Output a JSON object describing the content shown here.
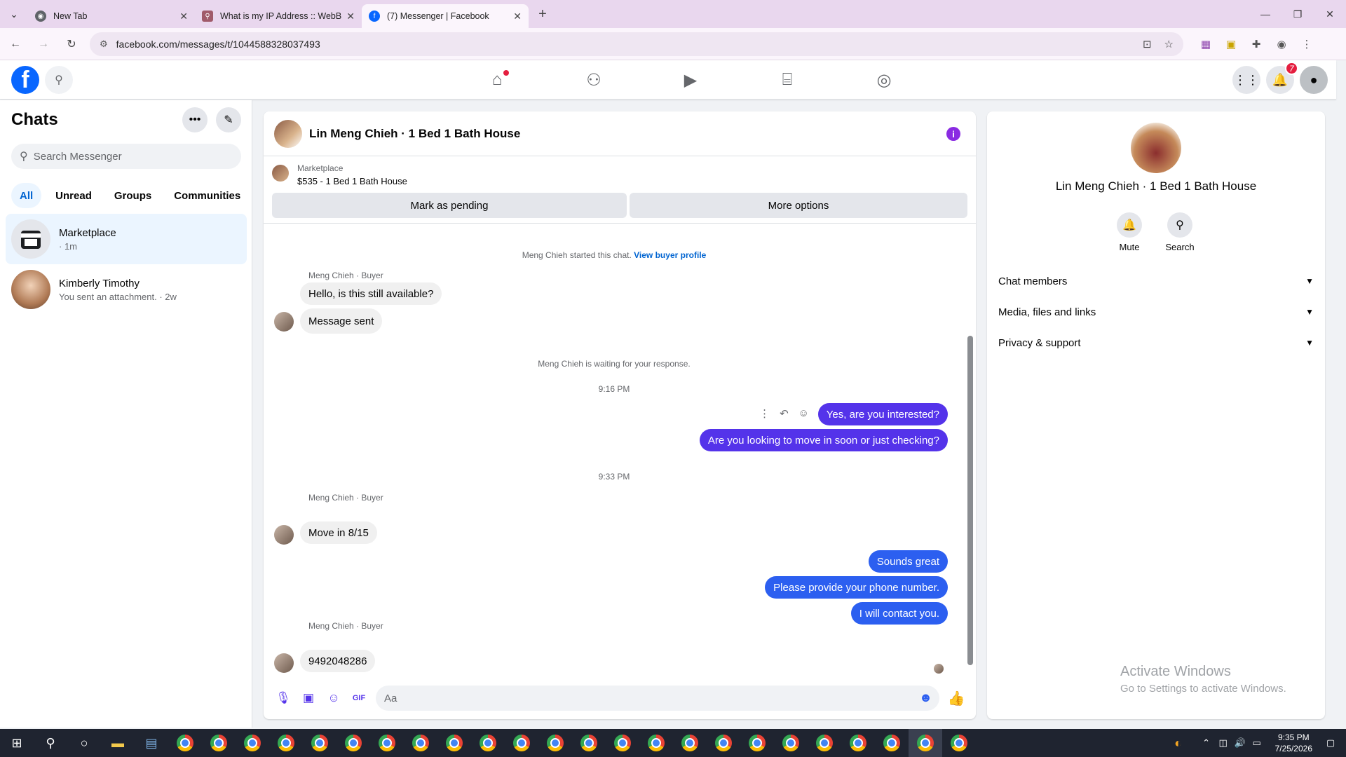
{
  "browser": {
    "tabs": [
      {
        "title": "New Tab",
        "active": false
      },
      {
        "title": "What is my IP Address :: WebBr",
        "active": false
      },
      {
        "title": "(7) Messenger | Facebook",
        "active": true
      }
    ],
    "url": "facebook.com/messages/t/1044588328037493"
  },
  "fb_header": {
    "notification_count": "7"
  },
  "sidebar": {
    "title": "Chats",
    "search_placeholder": "Search Messenger",
    "filters": [
      "All",
      "Unread",
      "Groups",
      "Communities"
    ],
    "chats": [
      {
        "name": "Marketplace",
        "preview": "· 1m"
      },
      {
        "name": "Kimberly Timothy",
        "preview": "You sent an attachment. · 2w"
      }
    ]
  },
  "conversation": {
    "title": "Lin Meng Chieh · 1 Bed 1 Bath House",
    "marketplace_label": "Marketplace",
    "listing": "$535 - 1 Bed 1 Bath House",
    "mark_pending": "Mark as pending",
    "more_options": "More options",
    "started_text": "Meng Chieh started this chat.",
    "view_buyer_profile": "View buyer profile",
    "sender_label": "Meng Chieh · Buyer",
    "msg1": "Hello, is this still available?",
    "msg2": "Message sent",
    "waiting_text": "Meng Chieh is waiting for your response.",
    "time1": "9:16 PM",
    "out1": "Yes, are you interested?",
    "out2": "Are you looking to move in soon or just checking?",
    "time2": "9:33 PM",
    "msg3": "Move in 8/15",
    "out3": "Sounds great",
    "out4": "Please provide your phone number.",
    "out5": "I will contact you.",
    "msg4": "9492048286",
    "composer_placeholder": "Aa"
  },
  "right_panel": {
    "name": "Lin Meng Chieh · 1 Bed 1 Bath House",
    "mute": "Mute",
    "search": "Search",
    "sections": [
      "Chat members",
      "Media, files and links",
      "Privacy & support"
    ],
    "watermark_title": "Activate Windows",
    "watermark_sub": "Go to Settings to activate Windows."
  },
  "taskbar": {
    "time": "9:35 PM",
    "date": "7/25/2026"
  }
}
